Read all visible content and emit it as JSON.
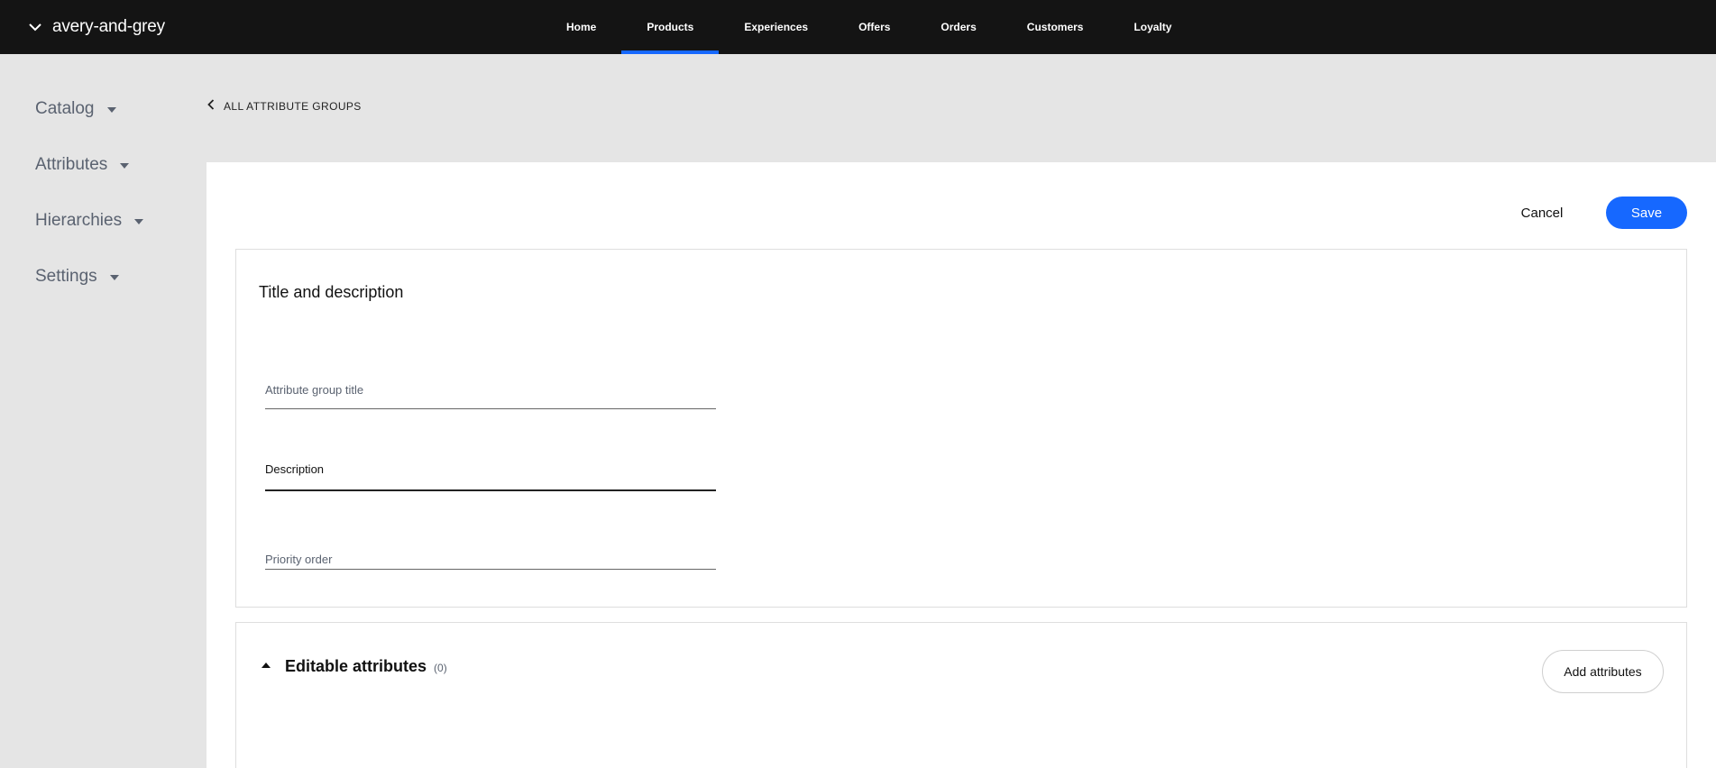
{
  "header": {
    "brand": "avery-and-grey",
    "nav": [
      {
        "label": "Home",
        "active": false
      },
      {
        "label": "Products",
        "active": true
      },
      {
        "label": "Experiences",
        "active": false
      },
      {
        "label": "Offers",
        "active": false
      },
      {
        "label": "Orders",
        "active": false
      },
      {
        "label": "Customers",
        "active": false
      },
      {
        "label": "Loyalty",
        "active": false
      }
    ],
    "accent_color": "#1668ff"
  },
  "sidebar": {
    "items": [
      {
        "label": "Catalog"
      },
      {
        "label": "Attributes"
      },
      {
        "label": "Hierarchies"
      },
      {
        "label": "Settings"
      }
    ]
  },
  "back_link": "ALL ATTRIBUTE GROUPS",
  "actions": {
    "cancel": "Cancel",
    "save": "Save"
  },
  "form": {
    "section_title": "Title and description",
    "fields": {
      "title": {
        "label": "Attribute group title",
        "value": ""
      },
      "description": {
        "label": "Description",
        "value": ""
      },
      "priority": {
        "label": "Priority order",
        "value": ""
      }
    }
  },
  "editable_attributes": {
    "title": "Editable attributes",
    "count": "(0)",
    "add_button": "Add attributes"
  }
}
